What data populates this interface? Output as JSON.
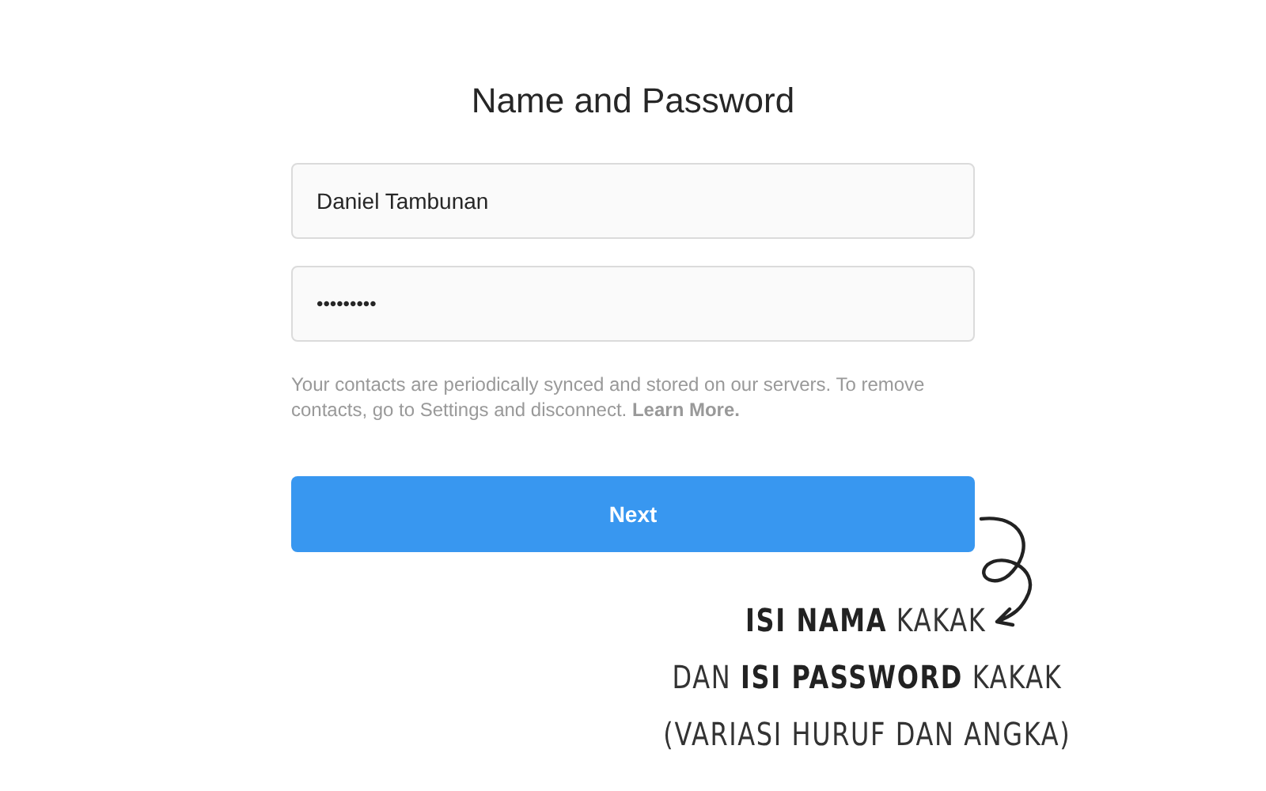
{
  "title": "Name and Password",
  "fields": [
    {
      "kind": "name",
      "value": "Daniel Tambunan"
    },
    {
      "kind": "password",
      "value": "•••••••••"
    }
  ],
  "note": {
    "text": "Your contacts are periodically synced and stored on our servers. To remove contacts, go to Settings and disconnect.",
    "link": "Learn More."
  },
  "next_button": "Next",
  "annotation": [
    "**ISI NAMA** KAKAK",
    "DAN **ISI PASSWORD** KAKAK",
    "(VARIASI HURUF DAN ANGKA)"
  ]
}
